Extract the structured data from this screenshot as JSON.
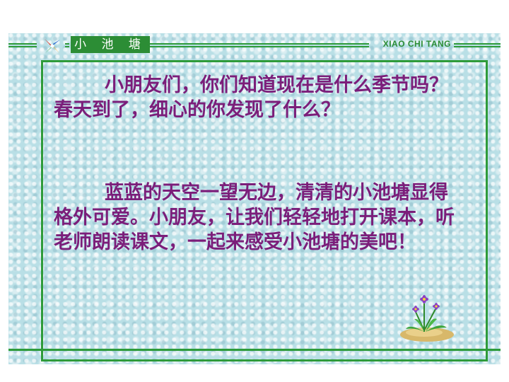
{
  "header": {
    "title": "小 池 塘",
    "en_title": "XIAO CHI TANG"
  },
  "content": {
    "paragraph1": "小朋友们，你们知道现在是什么季节吗？春天到了，细心的你发现了什么？",
    "paragraph2": "蓝蓝的天空一望无边，清清的小池塘显得格外可爱。小朋友，让我们轻轻地打开课本，听老师朗读课文，一起来感受小池塘的美吧！"
  },
  "colors": {
    "accent_green": "#2e9b3a",
    "text_purple": "#7b1e7a",
    "background_water": "#b9dfe6"
  },
  "icons": {
    "logo": "pinwheel-star-icon",
    "decoration": "flower-on-rock-icon"
  }
}
